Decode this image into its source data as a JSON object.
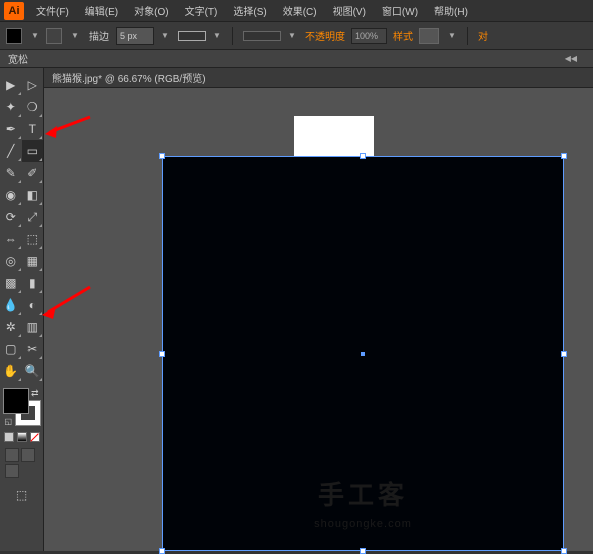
{
  "menubar": {
    "logo": "Ai",
    "items": [
      "文件(F)",
      "编辑(E)",
      "对象(O)",
      "文字(T)",
      "选择(S)",
      "效果(C)",
      "视图(V)",
      "窗口(W)",
      "帮助(H)"
    ]
  },
  "controlbar": {
    "stroke_label": "描边",
    "stroke_width": "5 px",
    "opacity_label": "不透明度",
    "opacity_value": "100%",
    "style_label": "样式",
    "align_label": "对"
  },
  "propbar": {
    "label": "宽松"
  },
  "doctab": {
    "name": "熊猫猴.jpg* @ 66.67% (RGB/预览)"
  },
  "watermark": {
    "main": "手工客",
    "sub": "shougongke.com"
  },
  "tools": {
    "row1": [
      "selection",
      "direct-select"
    ],
    "row2": [
      "magic-wand",
      "lasso"
    ],
    "row3": [
      "pen",
      "type"
    ],
    "row4": [
      "line",
      "rectangle"
    ],
    "row5": [
      "brush",
      "pencil"
    ],
    "row6": [
      "blob",
      "eraser"
    ],
    "row7": [
      "rotate",
      "scale"
    ],
    "row8": [
      "width",
      "free-transform"
    ],
    "row9": [
      "shape-builder",
      "perspective"
    ],
    "row10": [
      "mesh",
      "gradient"
    ],
    "row11": [
      "eyedropper",
      "blend"
    ],
    "row12": [
      "symbol",
      "graph"
    ],
    "row13": [
      "artboard",
      "slice"
    ],
    "row14": [
      "hand",
      "zoom"
    ]
  }
}
